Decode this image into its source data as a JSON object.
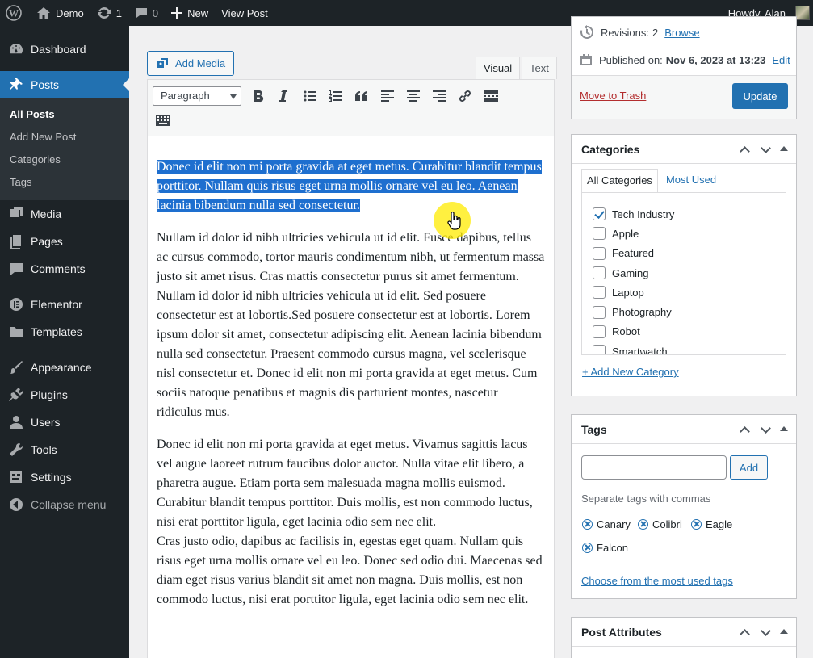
{
  "adminbar": {
    "site_name": "Demo",
    "updates_count": "1",
    "comments_count": "0",
    "new_label": "New",
    "view_post_label": "View Post",
    "greeting": "Howdy, Alan"
  },
  "sidebar": {
    "items": [
      {
        "label": "Dashboard",
        "icon": "dashboard-icon"
      },
      {
        "label": "Posts",
        "icon": "pin-icon"
      },
      {
        "label": "Media",
        "icon": "media-icon"
      },
      {
        "label": "Pages",
        "icon": "pages-icon"
      },
      {
        "label": "Comments",
        "icon": "comments-icon"
      },
      {
        "label": "Elementor",
        "icon": "elementor-icon"
      },
      {
        "label": "Templates",
        "icon": "folder-icon"
      },
      {
        "label": "Appearance",
        "icon": "brush-icon"
      },
      {
        "label": "Plugins",
        "icon": "plugin-icon"
      },
      {
        "label": "Users",
        "icon": "user-icon"
      },
      {
        "label": "Tools",
        "icon": "wrench-icon"
      },
      {
        "label": "Settings",
        "icon": "settings-icon"
      },
      {
        "label": "Collapse menu",
        "icon": "collapse-icon"
      }
    ],
    "submenu": [
      "All Posts",
      "Add New Post",
      "Categories",
      "Tags"
    ]
  },
  "editor": {
    "add_media_label": "Add Media",
    "tab_visual": "Visual",
    "tab_text": "Text",
    "format_value": "Paragraph",
    "paragraphs": [
      "Donec id elit non mi porta gravida at eget metus. Curabitur blandit tempus porttitor. Nullam quis risus eget urna mollis ornare vel eu leo. Aenean lacinia bibendum nulla sed consectetur.",
      "Nullam id dolor id nibh ultricies vehicula ut id elit. Fusce dapibus, tellus ac cursus commodo, tortor mauris condimentum nibh, ut fermentum massa justo sit amet risus. Cras mattis consectetur purus sit amet fermentum. Nullam id dolor id nibh ultricies vehicula ut id elit. Sed posuere consectetur est at lobortis.Sed posuere consectetur est at lobortis. Lorem ipsum dolor sit amet, consectetur adipiscing elit. Aenean lacinia bibendum nulla sed consectetur. Praesent commodo cursus magna, vel scelerisque nisl consectetur et. Donec id elit non mi porta gravida at eget metus. Cum sociis natoque penatibus et magnis dis parturient montes, nascetur ridiculus mus.",
      "Donec id elit non mi porta gravida at eget metus. Vivamus sagittis lacus vel augue laoreet rutrum faucibus dolor auctor. Nulla vitae elit libero, a pharetra augue. Etiam porta sem malesuada magna mollis euismod. Curabitur blandit tempus porttitor. Duis mollis, est non commodo luctus, nisi erat porttitor ligula, eget lacinia odio sem nec elit.",
      "Cras justo odio, dapibus ac facilisis in, egestas eget quam. Nullam quis risus eget urna mollis ornare vel eu leo. Donec sed odio dui. Maecenas sed diam eget risus varius blandit sit amet non magna. Duis mollis, est non commodo luctus, nisi erat porttitor ligula, eget lacinia odio sem nec elit."
    ]
  },
  "publish": {
    "revisions_label": "Revisions:",
    "revisions_count": "2",
    "browse_label": "Browse",
    "published_label": "Published on:",
    "published_date": "Nov 6, 2023 at 13:23",
    "edit_label": "Edit",
    "trash_label": "Move to Trash",
    "update_label": "Update"
  },
  "categories": {
    "title": "Categories",
    "tab_all": "All Categories",
    "tab_most_used": "Most Used",
    "items": [
      {
        "label": "Tech Industry",
        "checked": true
      },
      {
        "label": "Apple",
        "checked": false
      },
      {
        "label": "Featured",
        "checked": false
      },
      {
        "label": "Gaming",
        "checked": false
      },
      {
        "label": "Laptop",
        "checked": false
      },
      {
        "label": "Photography",
        "checked": false
      },
      {
        "label": "Robot",
        "checked": false
      },
      {
        "label": "Smartwatch",
        "checked": false
      }
    ],
    "add_new_label": "+ Add New Category"
  },
  "tags": {
    "title": "Tags",
    "input_value": "",
    "add_label": "Add",
    "help_text": "Separate tags with commas",
    "chips": [
      "Canary",
      "Colibri",
      "Eagle",
      "Falcon"
    ],
    "choose_label": "Choose from the most used tags"
  },
  "attributes": {
    "title": "Post Attributes"
  },
  "colors": {
    "accent": "#2271b1",
    "adminbar": "#1d2327",
    "selection": "#1e6fcf",
    "danger": "#b32d2e"
  }
}
